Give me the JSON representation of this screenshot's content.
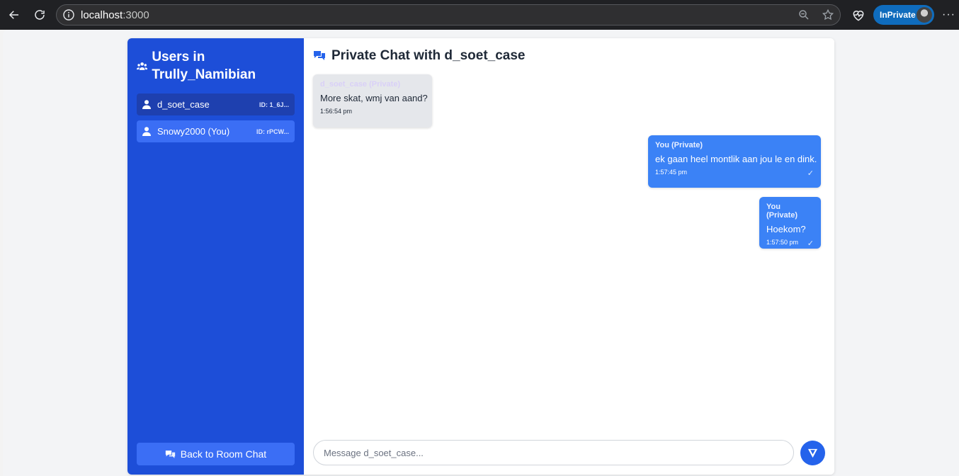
{
  "browser": {
    "url_host": "localhost",
    "url_port": ":3000",
    "inprivate_label": "InPrivate"
  },
  "sidebar": {
    "title": "Users in Trully_Namibian",
    "users": [
      {
        "name": "d_soet_case",
        "id": "ID: 1_6J...",
        "active": true
      },
      {
        "name": "Snowy2000 (You)",
        "id": "ID: rPCW...",
        "active": false
      }
    ],
    "back_label": "Back to Room Chat"
  },
  "chat": {
    "title": "Private Chat with d_soet_case",
    "messages": [
      {
        "sender": "d_soet_case (Private)",
        "text": "More skat, wmj van aand?",
        "time": "1:56:54 pm",
        "direction": "incoming"
      },
      {
        "sender": "You (Private)",
        "text": "ek gaan heel montlik aan jou le en dink.",
        "time": "1:57:45 pm",
        "direction": "outgoing",
        "status": "✓"
      },
      {
        "sender": "You (Private)",
        "text": "Hoekom?",
        "time": "1:57:50 pm",
        "direction": "outgoing",
        "status": "✓"
      }
    ],
    "input_placeholder": "Message d_soet_case..."
  },
  "colors": {
    "sidebar_bg": "#1d4ed8",
    "active_user": "#1e40af",
    "outgoing_bubble": "#3b82f6",
    "incoming_bubble": "#e5e7eb"
  }
}
